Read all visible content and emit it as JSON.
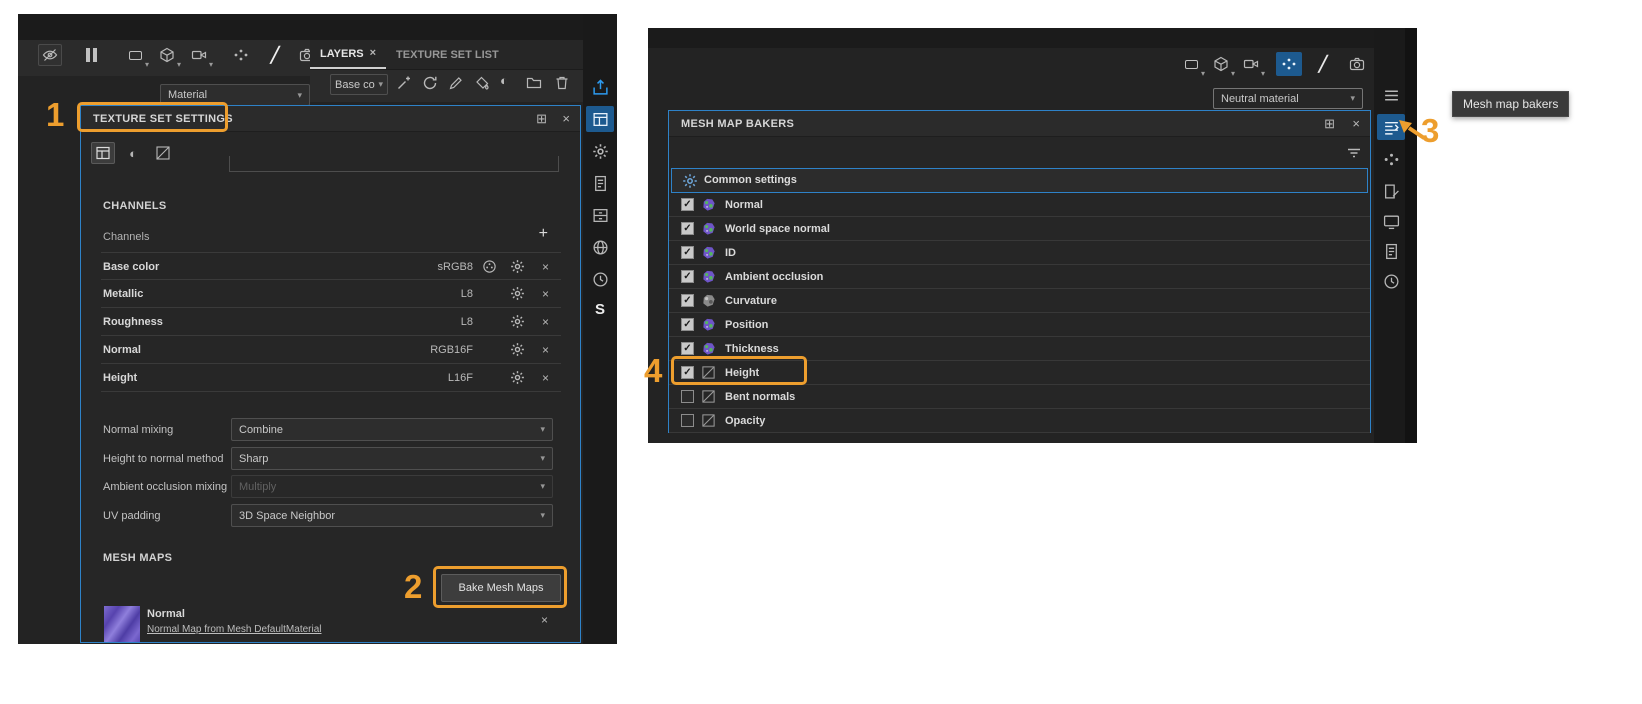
{
  "colors": {
    "accent_blue": "#2E82C8",
    "annotation_orange": "#ED9E2E",
    "selected_tool_bg": "#1D5A8F",
    "export_icon_blue": "#2D9BF0"
  },
  "icons": {
    "close": "×",
    "plus": "+",
    "caret": "▾",
    "check": "✓",
    "panel_grid": "⊞",
    "half_circle": "◐",
    "brush": "╱",
    "logo": "S"
  },
  "annotations": {
    "step_1": "1",
    "step_2": "2",
    "step_3": "3",
    "step_4": "4",
    "tooltip": "Mesh map bakers"
  },
  "left_window": {
    "tabs": [
      {
        "label": "LAYERS"
      },
      {
        "label": "TEXTURE SET LIST"
      }
    ],
    "material_dropdown": "Material",
    "layer_blend_dropdown": "Base co",
    "texture_set_settings": {
      "title": "TEXTURE SET SETTINGS",
      "channels_heading": "CHANNELS",
      "channels_label": "Channels",
      "channels": [
        {
          "name": "Base color",
          "format": "sRGB8"
        },
        {
          "name": "Metallic",
          "format": "L8"
        },
        {
          "name": "Roughness",
          "format": "L8"
        },
        {
          "name": "Normal",
          "format": "RGB16F"
        },
        {
          "name": "Height",
          "format": "L16F"
        }
      ],
      "settings": [
        {
          "label": "Normal mixing",
          "value": "Combine",
          "disabled": false
        },
        {
          "label": "Height to normal method",
          "value": "Sharp",
          "disabled": false
        },
        {
          "label": "Ambient occlusion mixing",
          "value": "Multiply",
          "disabled": true
        },
        {
          "label": "UV padding",
          "value": "3D Space Neighbor",
          "disabled": false
        }
      ],
      "mesh_maps_heading": "MESH MAPS",
      "bake_button": "Bake Mesh Maps",
      "mesh_map": {
        "name": "Normal",
        "description": "Normal Map from Mesh DefaultMaterial"
      }
    }
  },
  "right_window": {
    "material_dropdown": "Neutral material",
    "mesh_map_bakers": {
      "title": "MESH MAP BAKERS",
      "common_settings_label": "Common settings",
      "bakers": [
        {
          "name": "Normal",
          "checked": true,
          "icon": "mesh"
        },
        {
          "name": "World space normal",
          "checked": true,
          "icon": "mesh"
        },
        {
          "name": "ID",
          "checked": true,
          "icon": "mesh"
        },
        {
          "name": "Ambient occlusion",
          "checked": true,
          "icon": "mesh"
        },
        {
          "name": "Curvature",
          "checked": true,
          "icon": "meshgray"
        },
        {
          "name": "Position",
          "checked": true,
          "icon": "mesh"
        },
        {
          "name": "Thickness",
          "checked": true,
          "icon": "mesh"
        },
        {
          "name": "Height",
          "checked": true,
          "icon": "empty"
        },
        {
          "name": "Bent normals",
          "checked": false,
          "icon": "empty"
        },
        {
          "name": "Opacity",
          "checked": false,
          "icon": "empty"
        }
      ]
    }
  }
}
